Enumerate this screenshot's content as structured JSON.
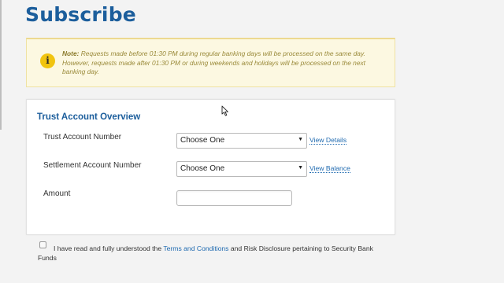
{
  "page": {
    "title": "Subscribe"
  },
  "notice": {
    "icon": "info-icon",
    "icon_glyph": "i",
    "accent_color": "#f1c40f",
    "note_label": "Note:",
    "text": "Requests made before 01:30 PM during regular banking days will be processed on the same day. However, requests made after 01:30 PM or during weekends and holidays will be processed on the next banking day."
  },
  "form": {
    "section_title": "Trust Account Overview",
    "trust_account": {
      "label": "Trust Account Number",
      "selected": "Choose One",
      "link": "View Details"
    },
    "settlement_account": {
      "label": "Settlement Account Number",
      "selected": "Choose One",
      "link": "View Balance"
    },
    "amount": {
      "label": "Amount",
      "value": ""
    }
  },
  "agreement": {
    "checked": false,
    "prefix": "I have read and fully understood the",
    "terms_link": "Terms and Conditions",
    "suffix": "and Risk Disclosure pertaining to Security Bank",
    "suffix_line2": "Funds"
  },
  "colors": {
    "brand_blue": "#1c5e9c",
    "link_blue": "#1f6ab0",
    "notice_bg": "#fcf8e1"
  }
}
